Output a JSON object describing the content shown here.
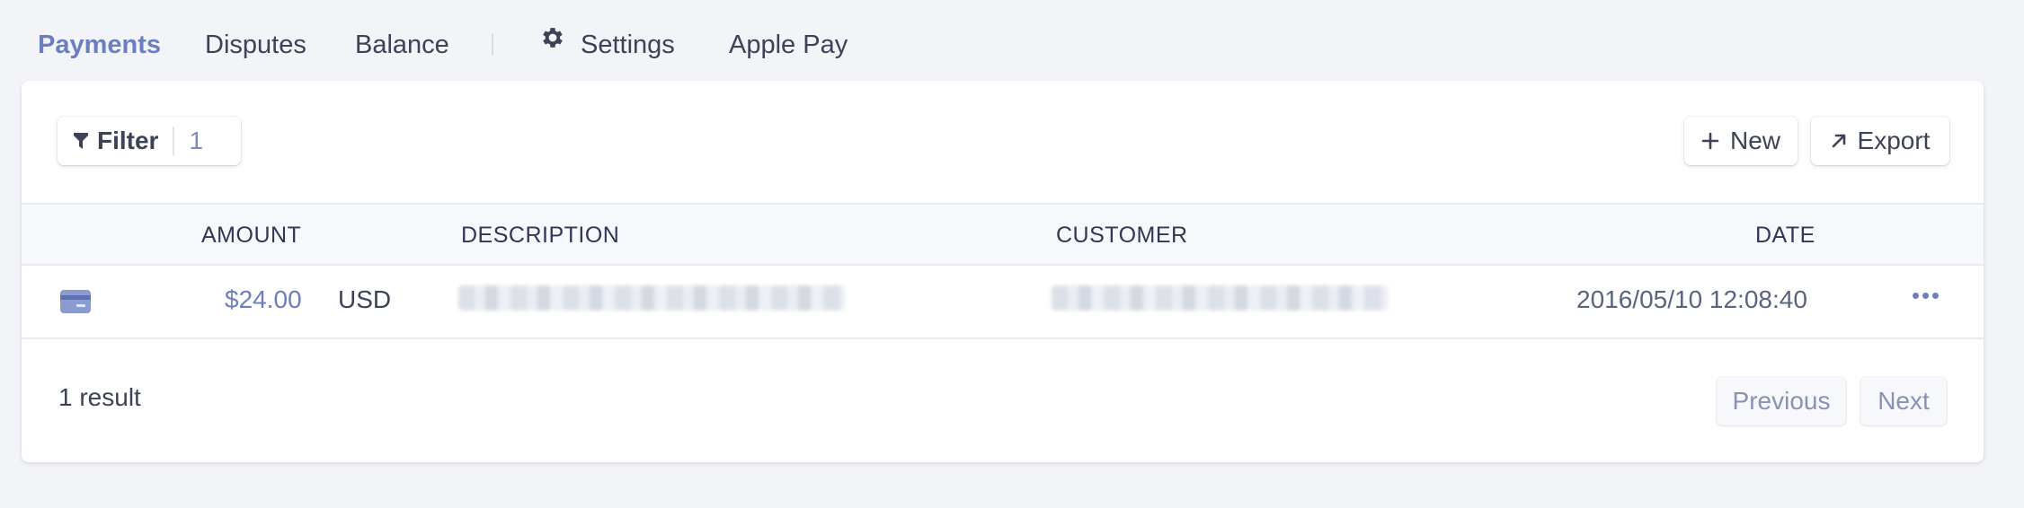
{
  "nav": {
    "payments": "Payments",
    "disputes": "Disputes",
    "balance": "Balance",
    "settings": "Settings",
    "apple_pay": "Apple Pay"
  },
  "toolbar": {
    "filter_label": "Filter",
    "filter_count": "1",
    "new_label": "New",
    "export_label": "Export"
  },
  "table": {
    "columns": {
      "amount": "AMOUNT",
      "description": "DESCRIPTION",
      "customer": "CUSTOMER",
      "date": "DATE"
    },
    "rows": [
      {
        "icon": "credit-card-icon",
        "amount": "$24.00",
        "currency": "USD",
        "date": "2016/05/10 12:08:40"
      }
    ]
  },
  "footer": {
    "result_count": "1 result",
    "previous_label": "Previous",
    "next_label": "Next"
  },
  "colors": {
    "accent": "#6b7fc0",
    "text": "#3c4257",
    "background": "#f2f4f8"
  }
}
